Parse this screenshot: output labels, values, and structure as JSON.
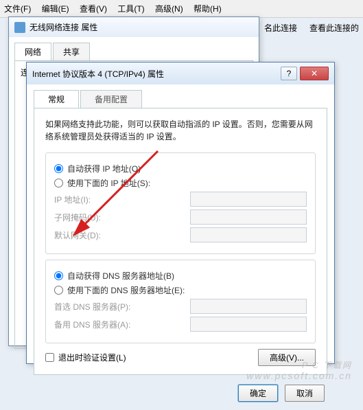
{
  "menubar": [
    "文件(F)",
    "编辑(E)",
    "查看(V)",
    "工具(T)",
    "高级(N)",
    "帮助(H)"
  ],
  "toolbar": {
    "rename": "名此连接",
    "diagnose": "查看此连接的"
  },
  "win1": {
    "title": "无线网络连接 属性",
    "tabs": {
      "network": "网络",
      "share": "共享"
    },
    "body_label": "连接时使用:"
  },
  "win2": {
    "title": "Internet 协议版本 4 (TCP/IPv4) 属性",
    "tabs": {
      "general": "常规",
      "alt": "备用配置"
    },
    "desc": "如果网络支持此功能，则可以获取自动指派的 IP 设置。否则，您需要从网络系统管理员处获得适当的 IP 设置。",
    "ip": {
      "auto": "自动获得 IP 地址(O)",
      "manual": "使用下面的 IP 地址(S):",
      "ip_label": "IP 地址(I):",
      "mask_label": "子网掩码(U):",
      "gw_label": "默认网关(D):"
    },
    "dns": {
      "auto": "自动获得 DNS 服务器地址(B)",
      "manual": "使用下面的 DNS 服务器地址(E):",
      "pref_label": "首选 DNS 服务器(P):",
      "alt_label": "备用 DNS 服务器(A):"
    },
    "validate": "退出时验证设置(L)",
    "advanced": "高级(V)...",
    "ok": "确定",
    "cancel": "取消"
  },
  "watermark": {
    "line1": "P C 下载网",
    "line2": "www.pcsoft.com.cn"
  }
}
